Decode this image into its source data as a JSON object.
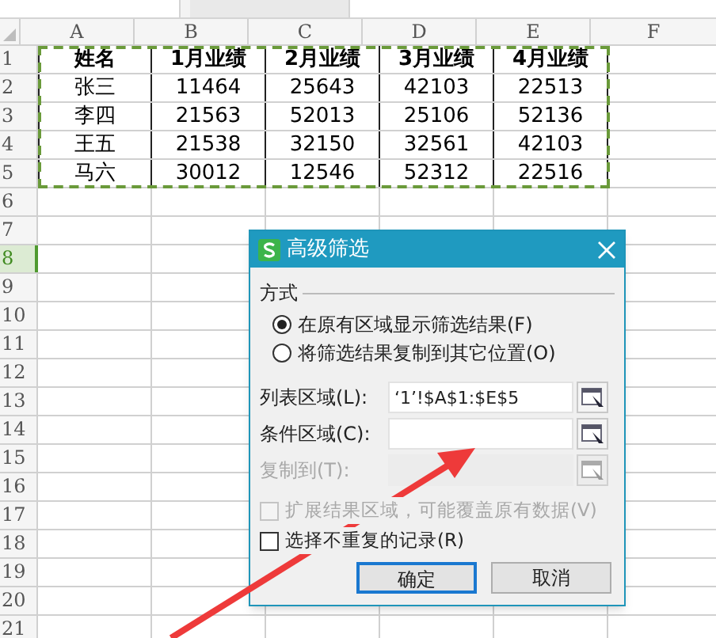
{
  "sheet": {
    "columns": [
      "A",
      "B",
      "C",
      "D",
      "E",
      "F"
    ],
    "rows": [
      {
        "number": "1",
        "selected": false,
        "header": true,
        "cells": [
          "姓名",
          "1月业绩",
          "2月业绩",
          "3月业绩",
          "4月业绩"
        ]
      },
      {
        "number": "2",
        "selected": false,
        "header": false,
        "cells": [
          "张三",
          "11464",
          "25643",
          "42103",
          "22513"
        ]
      },
      {
        "number": "3",
        "selected": false,
        "header": false,
        "cells": [
          "李四",
          "21563",
          "52013",
          "25106",
          "52136"
        ]
      },
      {
        "number": "4",
        "selected": false,
        "header": false,
        "cells": [
          "王五",
          "21538",
          "32150",
          "32561",
          "42103"
        ]
      },
      {
        "number": "5",
        "selected": false,
        "header": false,
        "cells": [
          "马六",
          "30012",
          "12546",
          "52312",
          "22516"
        ]
      },
      {
        "number": "6",
        "selected": false
      },
      {
        "number": "7",
        "selected": false
      },
      {
        "number": "8",
        "selected": true
      },
      {
        "number": "9",
        "selected": false
      },
      {
        "number": "10",
        "selected": false
      },
      {
        "number": "11",
        "selected": false
      },
      {
        "number": "12",
        "selected": false
      },
      {
        "number": "13",
        "selected": false
      },
      {
        "number": "14",
        "selected": false
      },
      {
        "number": "15",
        "selected": false
      },
      {
        "number": "16",
        "selected": false
      },
      {
        "number": "17",
        "selected": false
      },
      {
        "number": "18",
        "selected": false
      },
      {
        "number": "19",
        "selected": false
      },
      {
        "number": "20",
        "selected": false
      },
      {
        "number": "21",
        "selected": false
      }
    ]
  },
  "dialog": {
    "title": "高级筛选",
    "group": "方式",
    "options": [
      {
        "label": "在原有区域显示筛选结果(F)",
        "selected": true
      },
      {
        "label": "将筛选结果复制到其它位置(O)",
        "selected": false
      }
    ],
    "fields": [
      {
        "label": "列表区域(L):",
        "value": "‘1’!$A$1:$E$5",
        "disabled": false
      },
      {
        "label": "条件区域(C):",
        "disabled": false
      },
      {
        "label": "复制到(T):",
        "disabled": true
      }
    ],
    "checkboxes": [
      {
        "label": "扩展结果区域，可能覆盖原有数据(V)",
        "checked": false,
        "disabled": true
      },
      {
        "label": "选择不重复的记录(R)",
        "checked": false,
        "disabled": false
      }
    ],
    "buttons": [
      {
        "label": "确定",
        "default": true
      },
      {
        "label": "取消",
        "default": false
      }
    ]
  }
}
